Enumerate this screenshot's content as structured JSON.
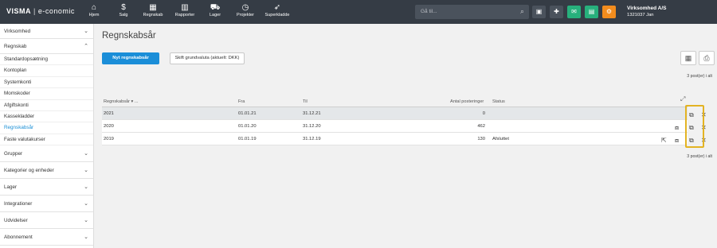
{
  "brand": {
    "logo": "VISMA",
    "separator": "|",
    "app": "e-conomic"
  },
  "nav": [
    {
      "icon": "home-icon",
      "glyph": "⌂",
      "label": "Hjem"
    },
    {
      "icon": "dollar-icon",
      "glyph": "$",
      "label": "Salg"
    },
    {
      "icon": "calculator-icon",
      "glyph": "▦",
      "label": "Regnskab"
    },
    {
      "icon": "bar-chart-icon",
      "glyph": "▥",
      "label": "Rapporter"
    },
    {
      "icon": "truck-icon",
      "glyph": "⛟",
      "label": "Lager"
    },
    {
      "icon": "clock-icon",
      "glyph": "◷",
      "label": "Projekter"
    },
    {
      "icon": "rocket-icon",
      "glyph": "➶",
      "label": "Superkladde"
    }
  ],
  "search": {
    "placeholder": "Gå til..."
  },
  "company": {
    "name": "Virksomhed A/S",
    "user": "1321037 Jan"
  },
  "sidebar": {
    "top": "Virksomhed",
    "regnskab": "Regnskab",
    "regnskab_items": [
      "Standardopsætning",
      "Kontoplan",
      "Systemkonti",
      "Momskoder",
      "Afgiftskonti",
      "Kassekladder",
      "Regnskabsår",
      "Faste valutakurser"
    ],
    "active": "Regnskabsår",
    "sections": [
      "Grupper",
      "Kategorier og enheder",
      "Lager",
      "Integrationer",
      "Udvidelser",
      "Abonnement"
    ]
  },
  "main": {
    "title": "Regnskabsår",
    "new_button": "Nyt regnskabsår",
    "currency_button": "Skift grundvaluta (aktuelt: DKK)",
    "count_top": "3 post(er) i alt",
    "count_bottom": "3 post(er) i alt"
  },
  "table": {
    "headers": {
      "year": "Regnskabsår ▾ ...",
      "from": "Fra",
      "to": "Til",
      "postings": "Antal posteringer",
      "status": "Status"
    },
    "rows": [
      {
        "year": "2021",
        "from": "01.01.21",
        "to": "31.12.21",
        "postings": "0",
        "status": ""
      },
      {
        "year": "2020",
        "from": "01.01.20",
        "to": "31.12.20",
        "postings": "462",
        "status": ""
      },
      {
        "year": "2019",
        "from": "01.01.19",
        "to": "31.12.19",
        "postings": "130",
        "status": "Afsluttet"
      }
    ]
  },
  "colors": {
    "topbar": "#353c45",
    "primary": "#1b8ed8",
    "active_link": "#1a8fd6",
    "highlight": "#e3b323",
    "green_btn": "#27b07c",
    "orange_btn": "#f28c1d"
  }
}
